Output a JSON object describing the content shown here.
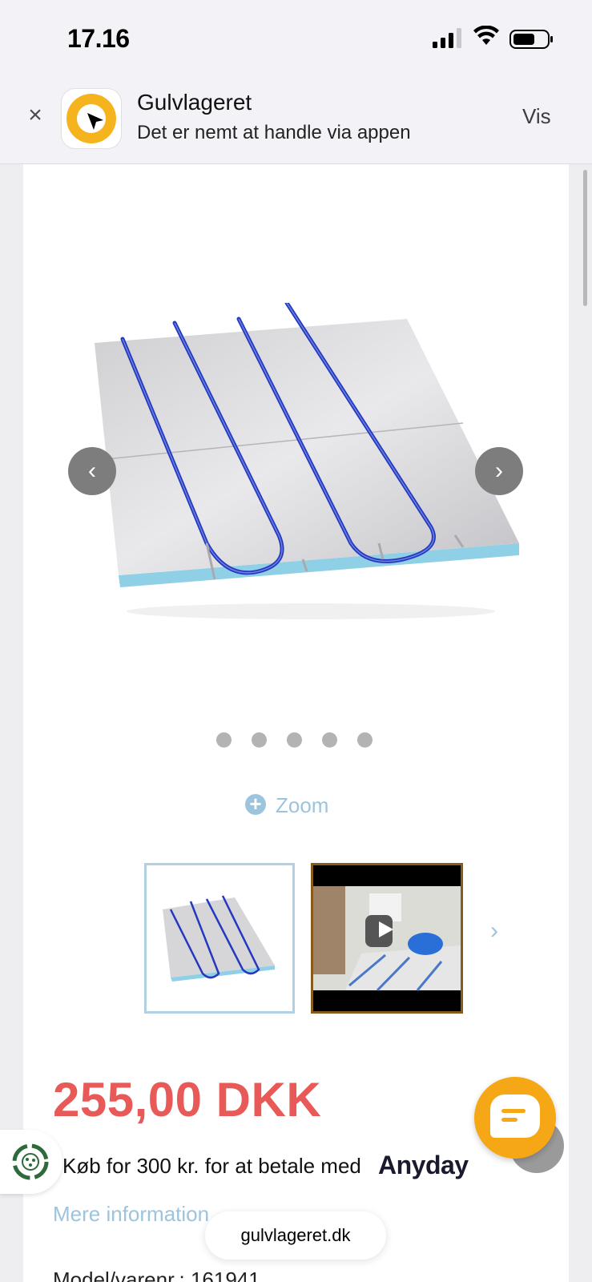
{
  "status_bar": {
    "time": "17.16"
  },
  "smart_banner": {
    "app_name": "Gulvlageret",
    "subtitle": "Det er nemt at handle via appen",
    "action_label": "Vis",
    "close_glyph": "×"
  },
  "gallery": {
    "prev_glyph": "‹",
    "next_glyph": "›",
    "dot_count": 5,
    "zoom_label": "Zoom",
    "thumb_next_glyph": "›"
  },
  "product": {
    "price": "255,00 DKK",
    "anyday_text": "Køb for 300 kr. for at betale med",
    "anyday_brand": "Anyday",
    "more_info_link": "Mere information",
    "model_line": "Model/varenr.: 161941"
  },
  "browser": {
    "domain": "gulvlageret.dk"
  },
  "colors": {
    "price": "#e85a58",
    "link": "#9cc4dd",
    "chat_button": "#f5a716",
    "app_icon_ring": "#f5b41e"
  }
}
